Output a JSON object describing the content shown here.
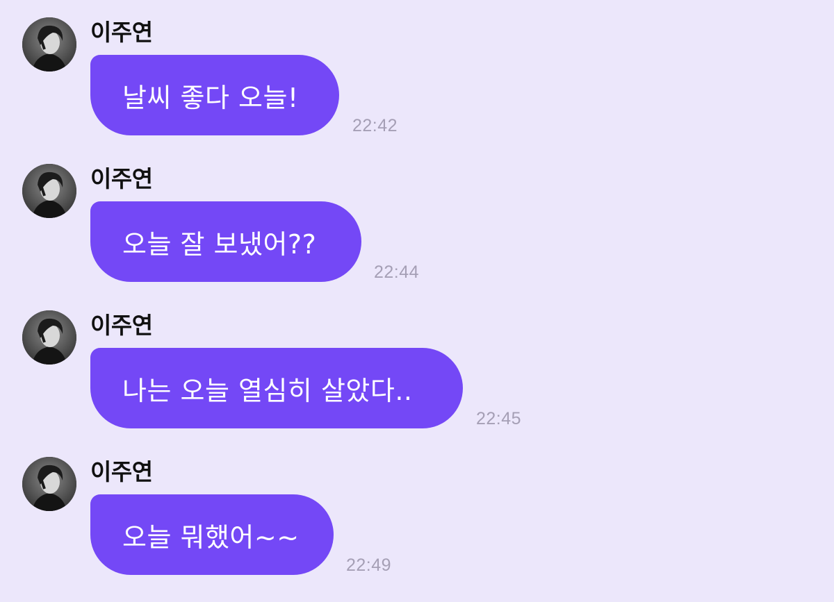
{
  "theme": {
    "background": "#ECE7FB",
    "bubble_color": "#7448F6",
    "bubble_text_color": "#FFFFFF",
    "time_color": "#A59FB5"
  },
  "messages": [
    {
      "sender": "이주연",
      "avatar_icon": "profile-photo",
      "text": "날씨 좋다 오늘!",
      "time": "22:42"
    },
    {
      "sender": "이주연",
      "avatar_icon": "profile-photo",
      "text": "오늘 잘 보냈어??",
      "time": "22:44"
    },
    {
      "sender": "이주연",
      "avatar_icon": "profile-photo",
      "text": "나는 오늘 열심히 살았다..",
      "time": "22:45"
    },
    {
      "sender": "이주연",
      "avatar_icon": "profile-photo",
      "text": "오늘 뭐했어~~",
      "time": "22:49"
    }
  ]
}
